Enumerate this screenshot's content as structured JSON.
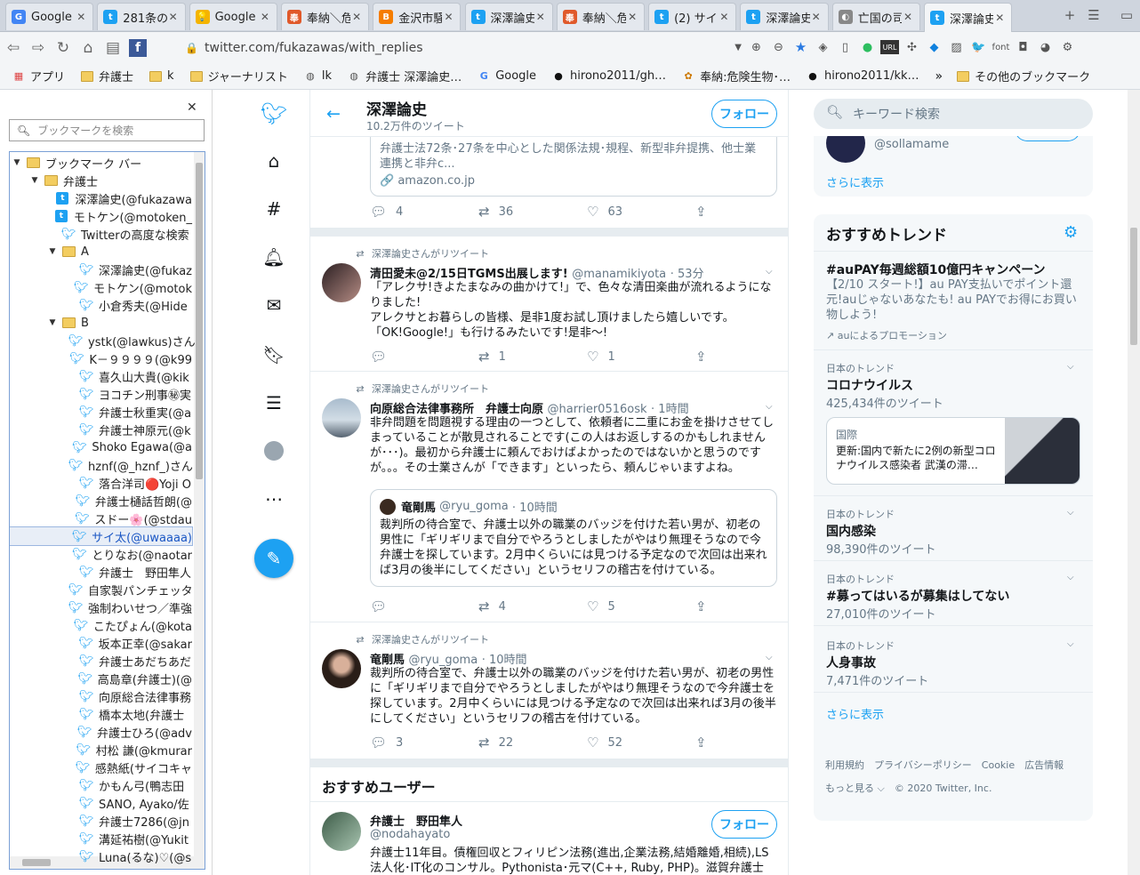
{
  "tabs": [
    {
      "title": "Google",
      "fav": "G",
      "color": "#4285f4"
    },
    {
      "title": "281条の",
      "fav": "t",
      "color": "#1da1f2"
    },
    {
      "title": "Google",
      "fav": "💡",
      "color": "#f4b400"
    },
    {
      "title": "奉納＼危",
      "fav": "奉",
      "color": "#e0592a"
    },
    {
      "title": "金沢市騒",
      "fav": "B",
      "color": "#f57d00"
    },
    {
      "title": "深澤論史",
      "fav": "t",
      "color": "#1da1f2"
    },
    {
      "title": "奉納＼危",
      "fav": "奉",
      "color": "#e0592a"
    },
    {
      "title": "(2) サイ",
      "fav": "t",
      "color": "#1da1f2"
    },
    {
      "title": "深澤論史",
      "fav": "t",
      "color": "#1da1f2"
    },
    {
      "title": "亡国の司",
      "fav": "◐",
      "color": "#888888"
    },
    {
      "title": "深澤論史",
      "fav": "t",
      "color": "#1da1f2"
    }
  ],
  "url": "twitter.com/fukazawas/with_replies",
  "bookmarks_bar": [
    "アプリ",
    "弁護士",
    "k",
    "ジャーナリスト",
    "lk",
    "弁護士 深澤論史…",
    "Google",
    "hirono2011/gh…",
    "奉納:危険生物･…",
    "hirono2011/kk…",
    "その他のブックマーク"
  ],
  "sidebar": {
    "search_placeholder": "ブックマークを検索",
    "tree": [
      {
        "label": "ブックマーク バー",
        "type": "folder",
        "depth": 0,
        "open": true
      },
      {
        "label": "弁護士",
        "type": "folder",
        "depth": 1,
        "open": true
      },
      {
        "label": "深澤論史(@fukazawa",
        "type": "tfav",
        "depth": 2
      },
      {
        "label": "モトケン(@motoken_",
        "type": "tfav",
        "depth": 2
      },
      {
        "label": "Twitterの高度な検索",
        "type": "bird",
        "depth": 2
      },
      {
        "label": "A",
        "type": "folder",
        "depth": 2,
        "open": true
      },
      {
        "label": "深澤論史(@fukaz",
        "type": "bird",
        "depth": 3
      },
      {
        "label": "モトケン(@motok",
        "type": "bird",
        "depth": 3
      },
      {
        "label": "小倉秀夫(@Hide",
        "type": "bird",
        "depth": 3
      },
      {
        "label": "B",
        "type": "folder",
        "depth": 2,
        "open": true
      },
      {
        "label": "ystk(@lawkus)さん",
        "type": "bird",
        "depth": 3
      },
      {
        "label": "K－９９９９(@k99",
        "type": "bird",
        "depth": 3
      },
      {
        "label": "喜久山大貴(@kik",
        "type": "bird",
        "depth": 3
      },
      {
        "label": "ヨコチン刑事㊙実",
        "type": "bird",
        "depth": 3
      },
      {
        "label": "弁護士秋重実(@a",
        "type": "bird",
        "depth": 3
      },
      {
        "label": "弁護士神原元(@k",
        "type": "bird",
        "depth": 3
      },
      {
        "label": "Shoko Egawa(@a",
        "type": "bird",
        "depth": 3
      },
      {
        "label": "hznf(@_hznf_)さん",
        "type": "bird",
        "depth": 3
      },
      {
        "label": "落合洋司🔴Yoji O",
        "type": "bird",
        "depth": 3
      },
      {
        "label": "弁護士樋話哲朗(@",
        "type": "bird",
        "depth": 3
      },
      {
        "label": "スドー🌸(@stdau",
        "type": "bird",
        "depth": 3
      },
      {
        "label": "サイ太(@uwaaaa)",
        "type": "bird",
        "depth": 3,
        "selected": true
      },
      {
        "label": "とりなお(@naotar",
        "type": "bird",
        "depth": 3
      },
      {
        "label": "弁護士　野田隼人",
        "type": "bird",
        "depth": 3
      },
      {
        "label": "自家製パンチェッタ",
        "type": "bird",
        "depth": 3
      },
      {
        "label": "強制わいせつ／準強",
        "type": "bird",
        "depth": 3
      },
      {
        "label": "こたぴょん(@kota",
        "type": "bird",
        "depth": 3
      },
      {
        "label": "坂本正幸(@sakar",
        "type": "bird",
        "depth": 3
      },
      {
        "label": "弁護士あだちあだ",
        "type": "bird",
        "depth": 3
      },
      {
        "label": "高島章(弁護士)(@",
        "type": "bird",
        "depth": 3
      },
      {
        "label": "向原総合法律事務",
        "type": "bird",
        "depth": 3
      },
      {
        "label": "橋本太地(弁護士",
        "type": "bird",
        "depth": 3
      },
      {
        "label": "弁護士ひろ(@adv",
        "type": "bird",
        "depth": 3
      },
      {
        "label": "村松 謙(@kmurar",
        "type": "bird",
        "depth": 3
      },
      {
        "label": "感熱紙(サイコキャ",
        "type": "bird",
        "depth": 3
      },
      {
        "label": "かもん弓(鴨志田",
        "type": "bird",
        "depth": 3
      },
      {
        "label": "SANO, Ayako/佐",
        "type": "bird",
        "depth": 3
      },
      {
        "label": "弁護士7286(@jn",
        "type": "bird",
        "depth": 3
      },
      {
        "label": "溝延祐樹(@Yukit",
        "type": "bird",
        "depth": 3
      },
      {
        "label": "Luna(るな)♡(@s",
        "type": "bird",
        "depth": 3
      }
    ]
  },
  "profile": {
    "name": "深澤論史",
    "tweet_count": "10.2万件のツイート",
    "follow_label": "フォロー"
  },
  "top_card": {
    "text": "弁護士法72条･27条を中心とした関係法規･規程、新型非弁提携、他士業連携と非弁c...",
    "link": "amazon.co.jp",
    "replies": "4",
    "retweets": "36",
    "likes": "63"
  },
  "tweets": [
    {
      "rt_label": "深澤論史さんがリツイート",
      "name": "清田愛未@2/15日TGMS出展します!",
      "handle": "@manamikiyota",
      "time": "· 53分",
      "text": "「アレクサ!きよたまなみの曲かけて!」で、色々な清田楽曲が流れるようになりました!\nアレクサとお暮らしの皆様、是非1度お試し頂けましたら嬉しいです。\n「OK!Google!」も行けるみたいです!是非〜!",
      "replies": "",
      "retweets": "1",
      "likes": "1"
    },
    {
      "rt_label": "深澤論史さんがリツイート",
      "name": "向原総合法律事務所　弁護士向原",
      "handle": "@harrier0516osk",
      "time": "· 1時間",
      "text": "非弁問題を問題視する理由の一つとして、依頼者に二重にお金を掛けさせてしまっていることが散見されることです(この人はお返しするのかもしれませんが･･･)。最初から弁護士に頼んでおけばよかったのではないかと思うのですが。。。その士業さんが「できます」といったら、頼んじゃいますよね。",
      "quote": {
        "name": "竜剛馬",
        "handle": "@ryu_goma",
        "time": "· 10時間",
        "text": "裁判所の待合室で、弁護士以外の職業のバッジを付けた若い男が、初老の男性に「ギリギリまで自分でやろうとしましたがやはり無理そうなので今弁護士を探しています。2月中くらいには見つける予定なので次回は出来れば3月の後半にしてください」というセリフの稽古を付けている。"
      },
      "replies": "",
      "retweets": "4",
      "likes": "5"
    },
    {
      "rt_label": "深澤論史さんがリツイート",
      "name": "竜剛馬",
      "handle": "@ryu_goma",
      "time": "· 10時間",
      "text": "裁判所の待合室で、弁護士以外の職業のバッジを付けた若い男が、初老の男性に「ギリギリまで自分でやろうとしましたがやはり無理そうなので今弁護士を探しています。2月中くらいには見つける予定なので次回は出来れば3月の後半にしてください」というセリフの稽古を付けている。",
      "replies": "3",
      "retweets": "22",
      "likes": "52"
    }
  ],
  "recommend": {
    "title": "おすすめユーザー",
    "name": "弁護士　野田隼人",
    "handle": "@nodahayato",
    "bio": "弁護士11年目。債権回収とフィリピン法務(進出,企業法務,結婚離婚,相続),LS法人化･IT化のコンサル。Pythonista･元マ(C++, Ruby, PHP)。滋賀弁護士会。京",
    "follow_label": "フォロー"
  },
  "right": {
    "search_placeholder": "キーワード検索",
    "top_handle": "@sollamame",
    "show_more": "さらに表示",
    "trends_title": "おすすめトレンド",
    "promo": {
      "title": "#auPAY毎週総額10億円キャンペーン",
      "text": "【2/10 スタート!】au PAY支払いでポイント還元!auじゃないあなたも! au PAYでお得にお買い物しよう!",
      "by": "auによるプロモーション"
    },
    "trends": [
      {
        "meta": "日本のトレンド",
        "title": "コロナウイルス",
        "count": "425,434件のツイート"
      },
      {
        "meta": "日本のトレンド",
        "title": "国内感染",
        "count": "98,390件のツイート"
      },
      {
        "meta": "日本のトレンド",
        "title": "#募ってはいるが募集はしてない",
        "count": "27,010件のツイート"
      },
      {
        "meta": "日本のトレンド",
        "title": "人身事故",
        "count": "7,471件のツイート"
      }
    ],
    "news": {
      "category": "国際",
      "text": "更新:国内で新たに2例の新型コロナウイルス感染者 武漢の滞…"
    },
    "show_more2": "さらに表示",
    "footer1": "利用規約　プライバシーポリシー　Cookie　広告情報",
    "footer2": "もっと見る ⌵　© 2020 Twitter, Inc."
  }
}
